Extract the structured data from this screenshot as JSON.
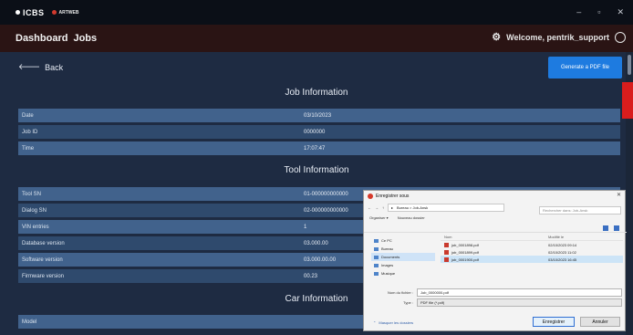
{
  "app": {
    "logo": "ICBS",
    "brand2": "ARTWEB"
  },
  "window_controls": {
    "minimize": "–",
    "maximize": "▫",
    "close": "✕"
  },
  "nav": {
    "crumb1": "Dashboard",
    "crumb2": "Jobs",
    "welcome": "Welcome, pentrik_support"
  },
  "back_label": "Back",
  "generate_button": "Generate a PDF file",
  "job_information": {
    "title": "Job Information",
    "rows": [
      {
        "key": "Date",
        "value": "03/10/2023"
      },
      {
        "key": "Job ID",
        "value": "0000000"
      },
      {
        "key": "Time",
        "value": "17:07:47"
      }
    ]
  },
  "tool_information": {
    "title": "Tool Information",
    "rows": [
      {
        "key": "Tool SN",
        "value": "01-000000000000"
      },
      {
        "key": "Dialog SN",
        "value": "02-000000000000"
      },
      {
        "key": "VIN entries",
        "value": "1"
      },
      {
        "key": "Database version",
        "value": "03.000.00"
      },
      {
        "key": "Software version",
        "value": "03.000.00.00"
      },
      {
        "key": "Firmware version",
        "value": "00.23"
      }
    ]
  },
  "car_information": {
    "title": "Car Information",
    "rows": [
      {
        "key": "Model",
        "value": ""
      }
    ]
  },
  "dialog": {
    "title": "Enregistrer sous",
    "path": "Bureau > Job-Ansk",
    "search_placeholder": "Rechercher dans: Job-Ansk",
    "organize": "Organiser ▾",
    "new_folder": "Nouveau dossier",
    "nav_items": [
      "Ce PC",
      "Bureau",
      "Documents",
      "Images",
      "Musique"
    ],
    "columns": {
      "name": "Nom",
      "date": "Modifié le"
    },
    "files": [
      {
        "name": "job_0001898.pdf",
        "date": "02/10/2023 09:14"
      },
      {
        "name": "job_0001899.pdf",
        "date": "02/10/2023 11:02"
      },
      {
        "name": "job_0001900.pdf",
        "date": "03/10/2023 16:45"
      }
    ],
    "filename_label": "Nom du fichier :",
    "filename_value": "Job_0000000.pdf",
    "type_label": "Type :",
    "type_value": "PDF file (*.pdf)",
    "hide_folders": "Masquer les dossiers",
    "save_label": "Enregistrer",
    "cancel_label": "Annuler"
  }
}
